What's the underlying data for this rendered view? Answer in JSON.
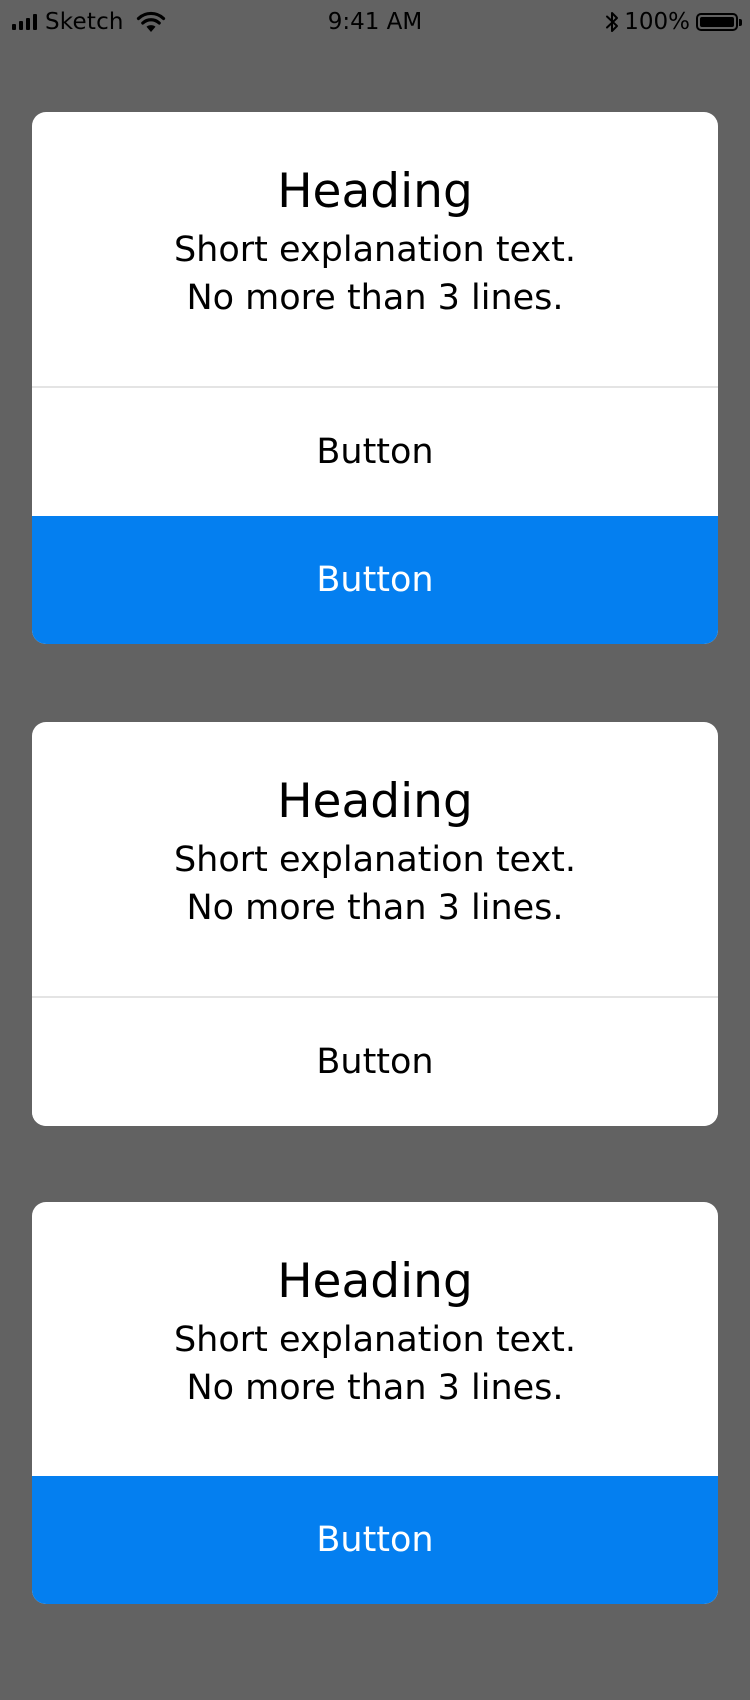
{
  "status_bar": {
    "carrier": "Sketch",
    "time": "9:41 AM",
    "battery_percent": "100%",
    "icons": [
      "signal-icon",
      "wifi-icon",
      "bluetooth-icon",
      "battery-icon"
    ]
  },
  "colors": {
    "background": "#626262",
    "card": "#ffffff",
    "primary": "#047ff0",
    "divider": "#e4e4e4"
  },
  "cards": [
    {
      "heading": "Heading",
      "text_line_1": "Short explanation text.",
      "text_line_2": "No more than 3 lines.",
      "secondary_button": "Button",
      "primary_button": "Button"
    },
    {
      "heading": "Heading",
      "text_line_1": "Short explanation text.",
      "text_line_2": "No more than 3 lines.",
      "secondary_button": "Button"
    },
    {
      "heading": "Heading",
      "text_line_1": "Short explanation text.",
      "text_line_2": "No more than 3 lines.",
      "primary_button": "Button"
    }
  ]
}
